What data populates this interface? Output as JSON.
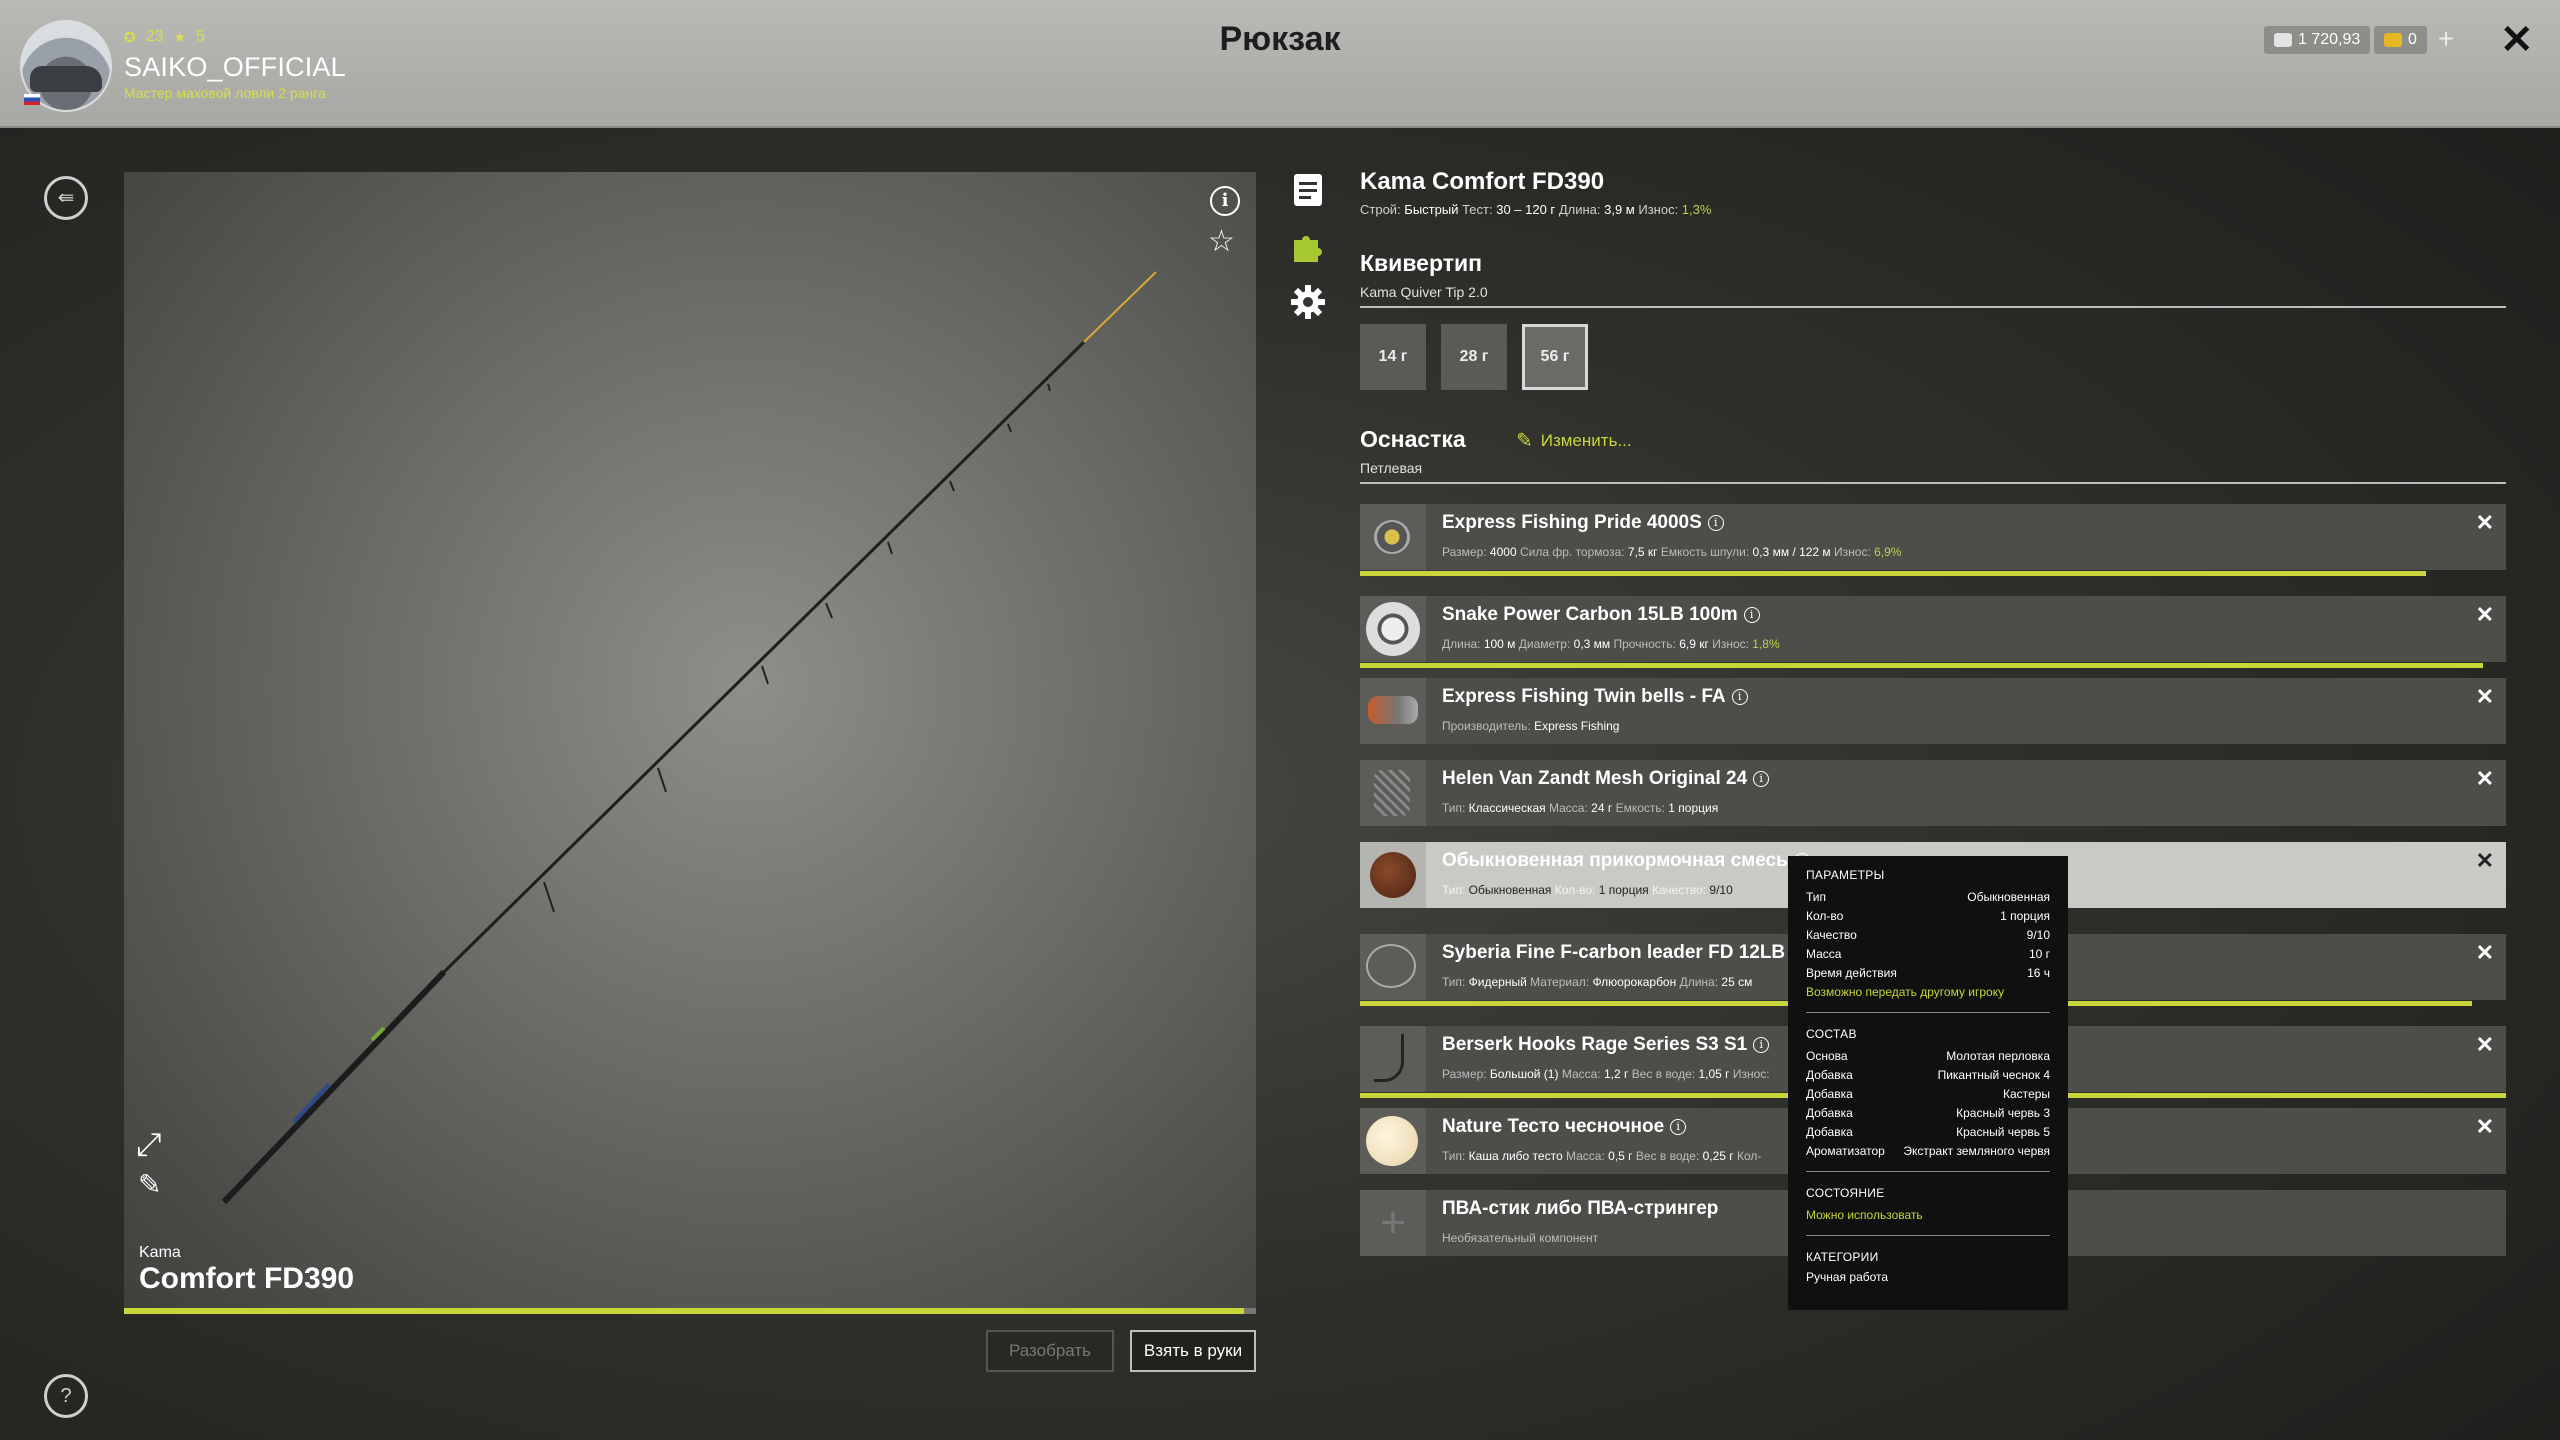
{
  "header": {
    "player_level": "23",
    "player_stars": "5",
    "username": "SAIKO_OFFICIAL",
    "rank": "Мастер маховой ловли 2 ранга",
    "title": "Рюкзак",
    "silver": "1 720,93",
    "gold": "0",
    "plus": "+",
    "close": "✕"
  },
  "rod": {
    "brand": "Kama",
    "model": "Comfort FD390",
    "wear_fraction": 0.99,
    "disassemble_label": "Разобрать",
    "take_label": "Взять в руки"
  },
  "details": {
    "title": "Kama Comfort FD390",
    "props": [
      {
        "k": "Строй:",
        "v": "Быстрый"
      },
      {
        "k": "Тест:",
        "v": "30 – 120 г"
      },
      {
        "k": "Длина:",
        "v": "3,9 м"
      },
      {
        "k": "Износ:",
        "v": "1,3%"
      }
    ],
    "quiver_title": "Квивертип",
    "quiver_sub": "Kama Quiver Tip 2.0",
    "weights": [
      "14 г",
      "28 г",
      "56 г"
    ],
    "selected_weight": 2,
    "rig_title": "Оснастка",
    "rig_sub": "Петлевая",
    "edit_label": "Изменить..."
  },
  "rig": [
    {
      "name": "Express Fishing Pride 4000S",
      "props": [
        [
          "Размер:",
          "4000"
        ],
        [
          "Сила фр. тормоза:",
          "7,5 кг"
        ],
        [
          "Емкость шпули:",
          "0,3 мм / 122 м"
        ],
        [
          "Износ:",
          "6,9%"
        ]
      ],
      "wear": 0.93,
      "thumb": "reel"
    },
    {
      "name": "Snake Power Carbon 15LB 100m",
      "props": [
        [
          "Длина:",
          "100 м"
        ],
        [
          "Диаметр:",
          "0,3 мм"
        ],
        [
          "Прочность:",
          "6,9 кг"
        ],
        [
          "Износ:",
          "1,8%"
        ]
      ],
      "wear": 0.98,
      "thumb": "line"
    },
    {
      "name": "Express Fishing Twin bells - FA",
      "props": [
        [
          "Производитель:",
          "Express Fishing"
        ]
      ],
      "wear": null,
      "thumb": "bells"
    },
    {
      "name": "Helen Van Zandt Mesh Original 24",
      "props": [
        [
          "Тип:",
          "Классическая"
        ],
        [
          "Масса:",
          "24 г"
        ],
        [
          "Емкость:",
          "1 порция"
        ]
      ],
      "wear": null,
      "thumb": "feeder"
    },
    {
      "name": "Обыкновенная прикормочная смесь",
      "props": [
        [
          "Тип:",
          "Обыкновенная"
        ],
        [
          "Кол-во:",
          "1 порция"
        ],
        [
          "Качество:",
          "9/10"
        ]
      ],
      "wear": null,
      "thumb": "groundbait",
      "highlight": true
    },
    {
      "name": "Syberia Fine F-carbon leader FD 12LB",
      "props": [
        [
          "Тип:",
          "Фидерный"
        ],
        [
          "Материал:",
          "Флюорокарбон"
        ],
        [
          "Длина:",
          "25 см"
        ]
      ],
      "wear": 0.97,
      "thumb": "leader"
    },
    {
      "name": "Berserk Hooks Rage Series S3 S1",
      "props": [
        [
          "Размер:",
          "Большой (1)"
        ],
        [
          "Масса:",
          "1,2 г"
        ],
        [
          "Вес в воде:",
          "1,05 г"
        ],
        [
          "Износ:",
          ""
        ]
      ],
      "wear": 1.0,
      "thumb": "hook"
    },
    {
      "name": "Nature Тесто чесночное",
      "props": [
        [
          "Тип:",
          "Каша либо тесто"
        ],
        [
          "Масса:",
          "0,5 г"
        ],
        [
          "Вес в воде:",
          "0,25 г"
        ],
        [
          "Кол-",
          ""
        ]
      ],
      "wear": null,
      "thumb": "dough"
    },
    {
      "name": "ПВА-стик либо ПВА-стрингер",
      "props": [
        [
          "Необязательный компонент",
          ""
        ]
      ],
      "wear": null,
      "thumb": "plus"
    }
  ],
  "tooltip": {
    "params_title": "ПАРАМЕТРЫ",
    "params": [
      [
        "Тип",
        "Обыкновенная"
      ],
      [
        "Кол-во",
        "1 порция"
      ],
      [
        "Качество",
        "9/10"
      ],
      [
        "Масса",
        "10 г"
      ],
      [
        "Время действия",
        "16 ч"
      ]
    ],
    "transfer_note": "Возможно передать другому игроку",
    "composition_title": "СОСТАВ",
    "composition": [
      [
        "Основа",
        "Молотая перловка"
      ],
      [
        "Добавка",
        "Пикантный чеснок 4"
      ],
      [
        "Добавка",
        "Кастеры"
      ],
      [
        "Добавка",
        "Красный червь 3"
      ],
      [
        "Добавка",
        "Красный червь 5"
      ],
      [
        "Ароматизатор",
        "Экстракт земляного червя"
      ]
    ],
    "state_title": "СОСТОЯНИЕ",
    "state": "Можно использовать",
    "categories_title": "КАТЕГОРИИ",
    "categories": "Ручная работа"
  },
  "colors": {
    "accent": "#c8d63a",
    "wear_green": "#b7d54a",
    "tooltip_bg": "#101010"
  },
  "icons": [
    "back-icon",
    "help-icon",
    "info-icon",
    "star-icon",
    "expand-icon",
    "paint-icon",
    "list-icon",
    "puzzle-icon",
    "gear-icon",
    "edit-icon",
    "close-icon"
  ]
}
